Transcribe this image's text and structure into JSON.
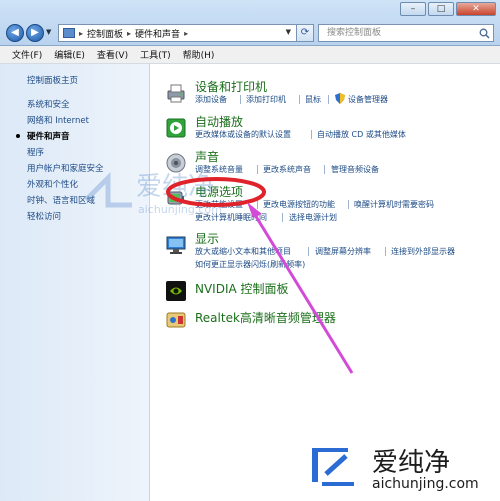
{
  "window": {
    "minimize": "–",
    "maximize": "□",
    "close": "✕"
  },
  "nav": {
    "back": "◀",
    "forward": "▶"
  },
  "address": {
    "crumbs": [
      "控制面板",
      "硬件和声音"
    ]
  },
  "search": {
    "placeholder": "搜索控制面板"
  },
  "menu": [
    "文件(F)",
    "编辑(E)",
    "查看(V)",
    "工具(T)",
    "帮助(H)"
  ],
  "sidebar": {
    "items": [
      {
        "label": "控制面板主页",
        "current": false
      },
      {
        "label": "系统和安全",
        "current": false
      },
      {
        "label": "网络和 Internet",
        "current": false
      },
      {
        "label": "硬件和声音",
        "current": true
      },
      {
        "label": "程序",
        "current": false
      },
      {
        "label": "用户帐户和家庭安全",
        "current": false
      },
      {
        "label": "外观和个性化",
        "current": false
      },
      {
        "label": "时钟、语言和区域",
        "current": false
      },
      {
        "label": "轻松访问",
        "current": false
      }
    ]
  },
  "categories": [
    {
      "title": "设备和打印机",
      "icon": "printer-icon",
      "links": [
        "添加设备",
        "添加打印机",
        "鼠标",
        "设备管理器"
      ]
    },
    {
      "title": "自动播放",
      "icon": "autoplay-icon",
      "links": [
        "更改媒体或设备的默认设置",
        "自动播放 CD 或其他媒体"
      ]
    },
    {
      "title": "声音",
      "icon": "speaker-icon",
      "links": [
        "调整系统音量",
        "更改系统声音",
        "管理音频设备"
      ]
    },
    {
      "title": "电源选项",
      "icon": "power-icon",
      "links": [
        "更改节能设置",
        "更改电源按钮的功能",
        "唤醒计算机时需要密码",
        "更改计算机睡眠时间",
        "选择电源计划"
      ]
    },
    {
      "title": "显示",
      "icon": "display-icon",
      "links": [
        "放大或缩小文本和其他项目",
        "调整屏幕分辨率",
        "连接到外部显示器",
        "如何更正显示器闪烁(刷新频率)"
      ]
    },
    {
      "title": "NVIDIA 控制面板",
      "icon": "nvidia-icon",
      "links": []
    },
    {
      "title": "Realtek高清晰音频管理器",
      "icon": "realtek-icon",
      "links": []
    }
  ],
  "watermark": {
    "text": "爱纯净",
    "sub": "aichunjing.com"
  },
  "logo": {
    "text": "爱纯净",
    "url_text": "aichunjing.com"
  },
  "colors": {
    "annotation": "#e0222a",
    "arrow": "#d44ad8",
    "link": "#1d4b86",
    "category": "#1a6f1a"
  }
}
